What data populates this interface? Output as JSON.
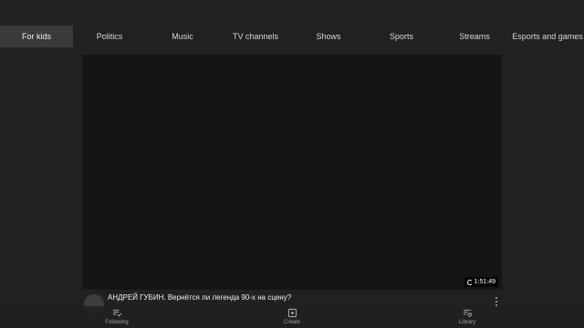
{
  "tabs": [
    {
      "label": "For kids",
      "active": true
    },
    {
      "label": "Politics"
    },
    {
      "label": "Music"
    },
    {
      "label": "TV channels"
    },
    {
      "label": "Shows"
    },
    {
      "label": "Sports"
    },
    {
      "label": "Streams"
    },
    {
      "label": "Esports and games"
    }
  ],
  "video": {
    "title": "АНДРЕЙ ГУБИН. Вернётся ли легенда 90-х на сцену?",
    "subtitle": "",
    "duration": "1:51:49"
  },
  "bottom_nav": {
    "following": {
      "label": "Following",
      "icon": "following-list-icon"
    },
    "create": {
      "label": "Create",
      "icon": "create-plus-icon"
    },
    "library": {
      "label": "Library",
      "icon": "library-heart-icon"
    }
  },
  "colors": {
    "background": "#212121",
    "active_tab": "#3a3a3a",
    "player": "#151515"
  }
}
